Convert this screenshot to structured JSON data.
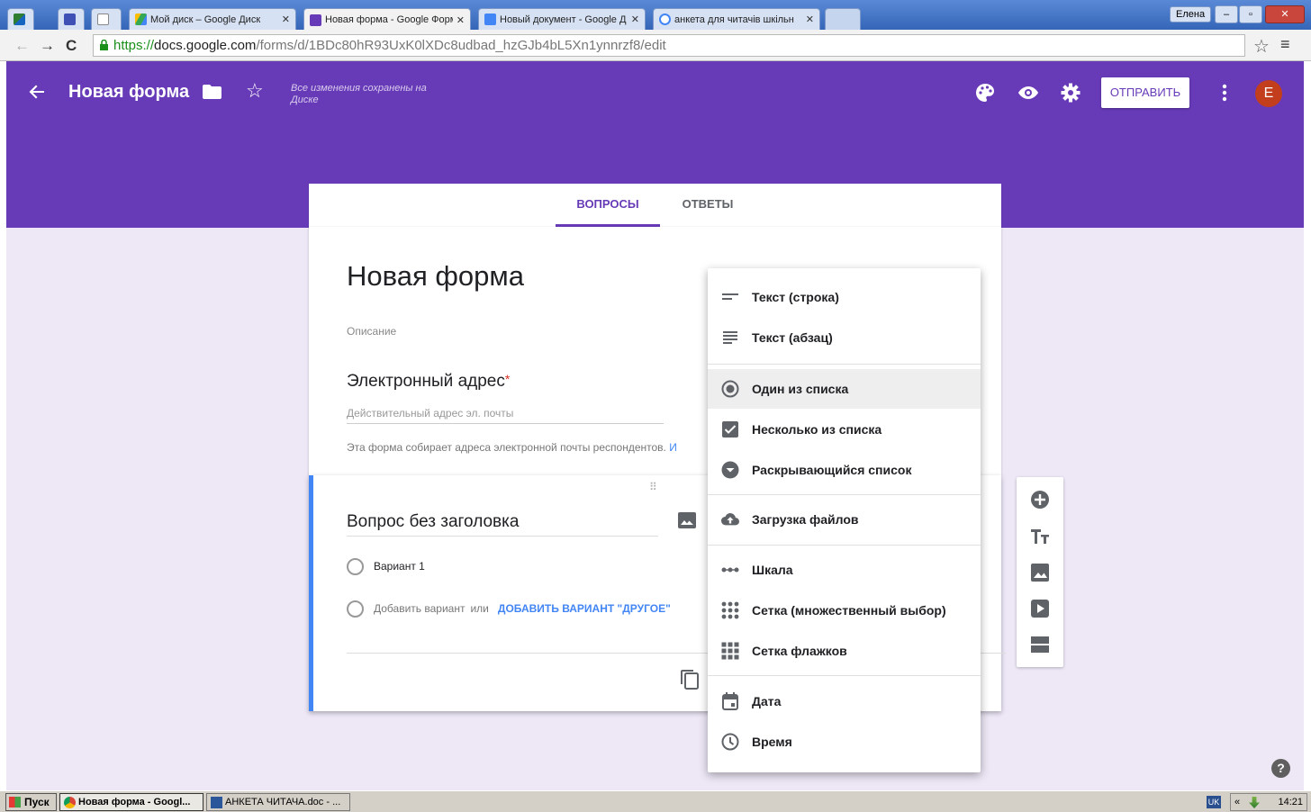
{
  "browser": {
    "tabs": [
      {
        "title": "",
        "favicon": "generic-icon"
      },
      {
        "title": "",
        "favicon": "generic-icon"
      },
      {
        "title": "",
        "favicon": "blank-page-icon"
      },
      {
        "title": "Мой диск – Google Диск",
        "favicon": "drive-icon"
      },
      {
        "title": "Новая форма - Google Форм",
        "favicon": "forms-icon",
        "active": true
      },
      {
        "title": "Новый документ - Google Д",
        "favicon": "docs-icon"
      },
      {
        "title": "анкета для читачів шкільн",
        "favicon": "google-icon"
      }
    ],
    "user_name": "Елена",
    "url_scheme": "https://",
    "url_host": "docs.google.com",
    "url_path": "/forms/d/1BDc80hR93UxK0lXDc8udbad_hzGJb4bL5Xn1ynnrzf8/edit"
  },
  "header": {
    "title": "Новая форма",
    "saved_status": "Все изменения сохранены на Диске",
    "send_label": "ОТПРАВИТЬ",
    "avatar_letter": "E",
    "accent_color": "#673ab7"
  },
  "form_tabs": [
    {
      "label": "ВОПРОСЫ",
      "active": true
    },
    {
      "label": "ОТВЕТЫ",
      "active": false
    }
  ],
  "title_card": {
    "title": "Новая форма",
    "description_placeholder": "Описание",
    "email_label": "Электронный адрес",
    "email_required_mark": "*",
    "email_placeholder": "Действительный адрес эл. почты",
    "email_note": "Эта форма собирает адреса электронной почты респондентов.",
    "email_note_link": "И"
  },
  "question": {
    "title": "Вопрос без заголовка",
    "option_1": "Вариант 1",
    "add_option": "Добавить вариант",
    "or_text": "или",
    "add_other": "ДОБАВИТЬ ВАРИАНТ \"ДРУГОЕ\""
  },
  "type_menu": {
    "items": [
      {
        "label": "Текст (строка)",
        "icon": "short-text-icon"
      },
      {
        "label": "Текст (абзац)",
        "icon": "paragraph-icon"
      },
      {
        "label": "Один из списка",
        "icon": "radio-button-icon",
        "selected": true
      },
      {
        "label": "Несколько из списка",
        "icon": "checkbox-icon"
      },
      {
        "label": "Раскрывающийся список",
        "icon": "dropdown-icon"
      },
      {
        "label": "Загрузка файлов",
        "icon": "cloud-upload-icon"
      },
      {
        "label": "Шкала",
        "icon": "linear-scale-icon"
      },
      {
        "label": "Сетка (множественный выбор)",
        "icon": "grid-radio-icon"
      },
      {
        "label": "Сетка флажков",
        "icon": "grid-checkbox-icon"
      },
      {
        "label": "Дата",
        "icon": "calendar-icon"
      },
      {
        "label": "Время",
        "icon": "clock-icon"
      }
    ]
  },
  "side_toolbar": [
    "add-question-icon",
    "add-title-icon",
    "add-image-icon",
    "add-video-icon",
    "add-section-icon"
  ],
  "help_glyph": "?",
  "taskbar": {
    "start_label": "Пуск",
    "tasks": [
      "Новая форма - Googl...",
      "АНКЕТА ЧИТАЧА.doc - ..."
    ],
    "lang": "UK",
    "clock": "14:21",
    "tray_chevron": "«"
  }
}
